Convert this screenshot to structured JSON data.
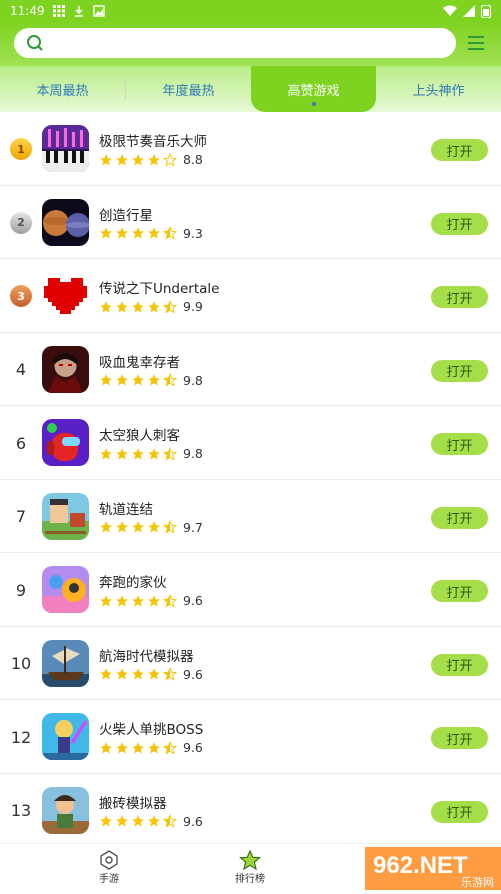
{
  "status_bar": {
    "time": "11:49"
  },
  "search": {
    "placeholder": ""
  },
  "tabs": [
    {
      "label": "本周最热",
      "active": false
    },
    {
      "label": "年度最热",
      "active": false
    },
    {
      "label": "高赞游戏",
      "active": true
    },
    {
      "label": "上头神作",
      "active": false
    }
  ],
  "games": [
    {
      "rank": "1",
      "medal": "gold",
      "name": "极限节奏音乐大师",
      "rating": "8.8",
      "stars": 4,
      "open_label": "打开"
    },
    {
      "rank": "2",
      "medal": "silver",
      "name": "创造行星",
      "rating": "9.3",
      "stars": 4.5,
      "open_label": "打开"
    },
    {
      "rank": "3",
      "medal": "bronze",
      "name": "传说之下Undertale",
      "rating": "9.9",
      "stars": 4.5,
      "open_label": "打开"
    },
    {
      "rank": "4",
      "medal": "",
      "name": "吸血鬼幸存者",
      "rating": "9.8",
      "stars": 4.5,
      "open_label": "打开"
    },
    {
      "rank": "6",
      "medal": "",
      "name": "太空狼人刺客",
      "rating": "9.8",
      "stars": 4.5,
      "open_label": "打开"
    },
    {
      "rank": "7",
      "medal": "",
      "name": "轨道连结",
      "rating": "9.7",
      "stars": 4.5,
      "open_label": "打开"
    },
    {
      "rank": "9",
      "medal": "",
      "name": "奔跑的家伙",
      "rating": "9.6",
      "stars": 4.5,
      "open_label": "打开"
    },
    {
      "rank": "10",
      "medal": "",
      "name": "航海时代模拟器",
      "rating": "9.6",
      "stars": 4.5,
      "open_label": "打开"
    },
    {
      "rank": "12",
      "medal": "",
      "name": "火柴人单挑BOSS",
      "rating": "9.6",
      "stars": 4.5,
      "open_label": "打开"
    },
    {
      "rank": "13",
      "medal": "",
      "name": "搬砖模拟器",
      "rating": "9.6",
      "stars": 4.5,
      "open_label": "打开"
    }
  ],
  "bottom_nav": [
    {
      "label": "手游",
      "icon": "gamepad-icon",
      "active": false
    },
    {
      "label": "排行榜",
      "icon": "star-icon",
      "active": true
    }
  ],
  "watermark": {
    "text": "962.NET",
    "subtext": "乐游网"
  },
  "colors": {
    "accent": "#7ed321",
    "button": "#a6de4a",
    "star": "#f5c400",
    "tab_text": "#2d7bb7"
  }
}
